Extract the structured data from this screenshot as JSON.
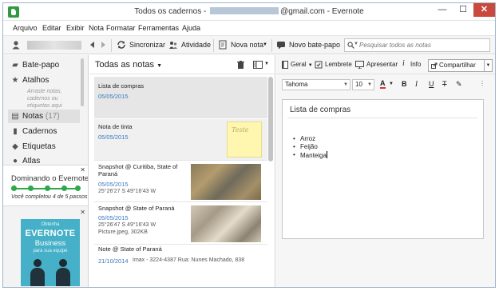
{
  "window": {
    "title_prefix": "Todos os cadernos - ",
    "title_suffix": "@gmail.com - Evernote",
    "min": "—",
    "max": "☐",
    "close": "✕"
  },
  "menu": [
    "Arquivo",
    "Editar",
    "Exibir",
    "Nota",
    "Formatar",
    "Ferramentas",
    "Ajuda"
  ],
  "toolbar": {
    "sync": "Sincronizar",
    "activity": "Atividade",
    "new_note": "Nova nota",
    "new_chat": "Novo bate-papo",
    "search_placeholder": "Pesquisar todos as notas"
  },
  "sidebar": {
    "chat": "Bate-papo",
    "shortcuts": "Atalhos",
    "shortcuts_hint": "Arraste notas, cadernos ou etiquetas aqui",
    "notes": "Notas",
    "notes_count": "(17)",
    "notebooks": "Cadernos",
    "tags": "Etiquetas",
    "atlas": "Atlas"
  },
  "promo": {
    "title": "Dominando o Evernote",
    "status": "Você completou 4 de 5 passos",
    "steps_done": 4,
    "steps_total": 5
  },
  "ad": {
    "line1": "Obtenha",
    "line2": "EVERNOTE",
    "line3": "Business",
    "line4": "para sua equipe"
  },
  "notes_list": {
    "header": "Todas as notas",
    "items": [
      {
        "title": "Lista de compras",
        "date": "05/05/2015"
      },
      {
        "title": "Nota de tinta",
        "date": "05/05/2015",
        "thumb_text": "Teste"
      },
      {
        "title": "Snapshot @ Curitiba, State of",
        "title2": "Paraná",
        "date": "05/05/2015",
        "coords": "25°26'27 S  49°16'43 W"
      },
      {
        "title": "Snapshot @ State of Paraná",
        "date": "05/05/2015",
        "coords": "25°26'47 S  49°16'43 W",
        "file": "Picture.jpeg,  302KB"
      },
      {
        "title": "Note @ State of Paraná",
        "date": "21/10/2014",
        "snippet": "Imax - 3224-4387 Rua: Nunes Machado, 838"
      }
    ]
  },
  "editor": {
    "notebook": "Geral",
    "reminder": "Lembrete",
    "present": "Apresentar",
    "info": "Info",
    "share": "Compartilhar",
    "font": "Tahoma",
    "size": "10",
    "note_title": "Lista de compras",
    "items": [
      "Arroz",
      "Feijão",
      "Manteiga"
    ]
  }
}
